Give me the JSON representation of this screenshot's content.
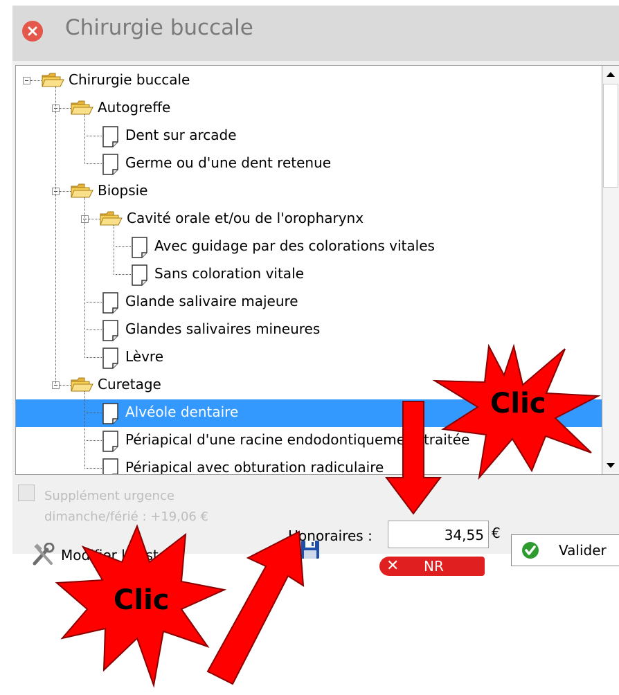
{
  "window": {
    "title": "Chirurgie buccale"
  },
  "tree": {
    "nodes": [
      {
        "label": "Chirurgie buccale",
        "type": "folder",
        "level": 0,
        "expanded": true
      },
      {
        "label": "Autogreffe",
        "type": "folder",
        "level": 1,
        "expanded": true
      },
      {
        "label": "Dent sur arcade",
        "type": "item",
        "level": 2
      },
      {
        "label": "Germe ou d'une dent retenue",
        "type": "item",
        "level": 2
      },
      {
        "label": "Biopsie",
        "type": "folder",
        "level": 1,
        "expanded": true
      },
      {
        "label": "Cavité orale et/ou de l'oropharynx",
        "type": "folder",
        "level": 2,
        "expanded": true
      },
      {
        "label": "Avec guidage par des colorations vitales",
        "type": "item",
        "level": 3
      },
      {
        "label": "Sans coloration vitale",
        "type": "item",
        "level": 3
      },
      {
        "label": "Glande salivaire majeure",
        "type": "item",
        "level": 2
      },
      {
        "label": "Glandes salivaires mineures",
        "type": "item",
        "level": 2
      },
      {
        "label": "Lèvre",
        "type": "item",
        "level": 2
      },
      {
        "label": "Curetage",
        "type": "folder",
        "level": 1,
        "expanded": true
      },
      {
        "label": "Alvéole dentaire",
        "type": "item",
        "level": 2,
        "selected": true
      },
      {
        "label": "Périapical d'une racine endodontiquement traitée",
        "type": "item",
        "level": 2
      },
      {
        "label": "Périapical avec obturation radiculaire",
        "type": "item",
        "level": 2
      }
    ]
  },
  "footer": {
    "supplement_label": "Supplément urgence\ndimanche/férié : +19,06 €",
    "honoraires_label": "Honoraires :",
    "honoraires_value": "34,55",
    "currency": "€",
    "valider_label": "Valider",
    "nr_label": "NR",
    "modifier_label": "Modifier la liste"
  },
  "annotations": {
    "clic_top": "Clic",
    "clic_bottom": "Clic"
  },
  "colors": {
    "selection": "#3399ff",
    "annotation_red": "#ff0000",
    "nr_red": "#e02020",
    "valider_green": "#2e9b2e"
  }
}
